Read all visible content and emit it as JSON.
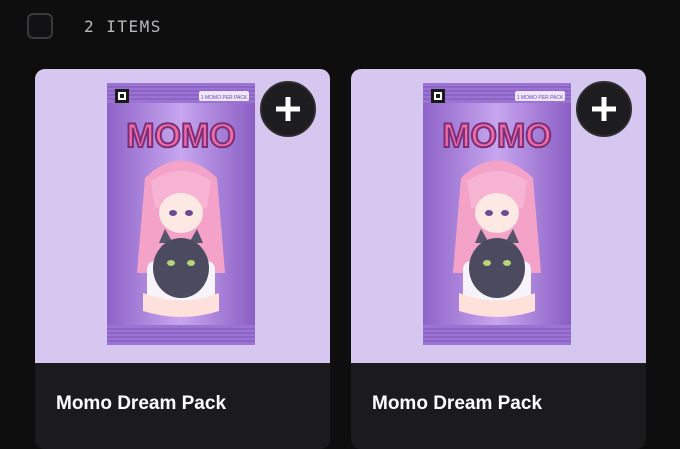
{
  "toolbar": {
    "item_count": "2 ITEMS"
  },
  "items": [
    {
      "title": "Momo Dream Pack",
      "pack_brand": "MOMO",
      "pack_tag": "1 MOMO PER PACK",
      "add_label": "+"
    },
    {
      "title": "Momo Dream Pack",
      "pack_brand": "MOMO",
      "pack_tag": "1 MOMO PER PACK",
      "add_label": "+"
    }
  ],
  "colors": {
    "background": "#0e0e0f",
    "card_media": "#d5c7ef",
    "pack_purple": "#a47fd8",
    "brand_pink": "#f06aa5"
  }
}
